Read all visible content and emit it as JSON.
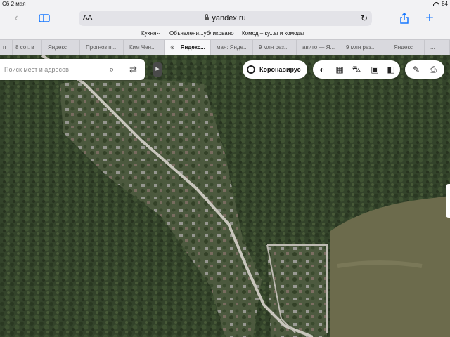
{
  "status": {
    "time": "Сб 2 мая",
    "battery": "84"
  },
  "toolbar": {
    "aa": "AA",
    "url": "yandex.ru"
  },
  "favorites": [
    "Кухня",
    "Объявлени...убликовано",
    "Комод – ку...ы и комоды"
  ],
  "tabs": [
    {
      "label": "п"
    },
    {
      "label": "8 сот. в"
    },
    {
      "label": "Яндекс"
    },
    {
      "label": "Прогноз п..."
    },
    {
      "label": "Ким Чен..."
    },
    {
      "label": "Яндекс...",
      "active": true
    },
    {
      "label": "мая: Янде..."
    },
    {
      "label": "9 млн рез..."
    },
    {
      "label": "авито — Я..."
    },
    {
      "label": "9 млн рез..."
    },
    {
      "label": "Яндекс"
    },
    {
      "label": "..."
    }
  ],
  "map": {
    "search_placeholder": "Поиск мест и адресов",
    "corona_label": "Коронавирус",
    "icons": [
      "search-icon",
      "route-icon",
      "layers-icon",
      "traffic-icon",
      "parking-icon",
      "transport-icon",
      "panorama-icon",
      "ruler-icon",
      "print-icon"
    ]
  }
}
